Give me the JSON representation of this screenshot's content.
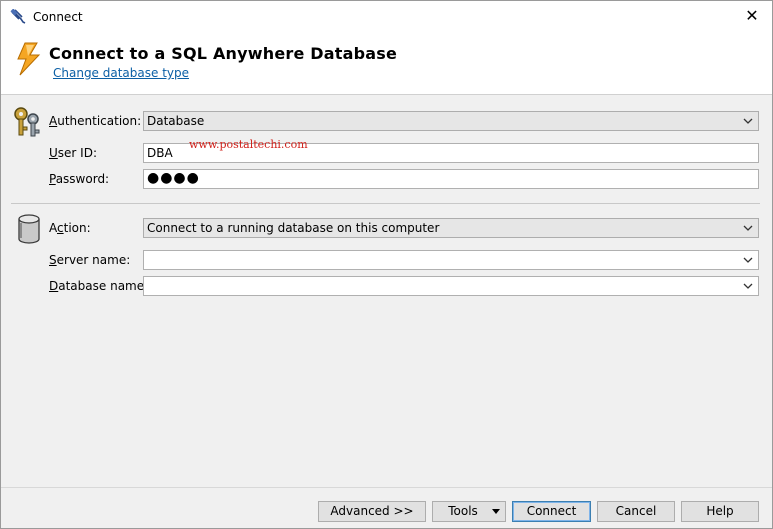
{
  "window": {
    "title": "Connect",
    "close_glyph": "✕"
  },
  "header": {
    "heading": "Connect to a SQL Anywhere Database",
    "change_type_link": "Change database type"
  },
  "auth_section": {
    "authentication_label_prefix": "",
    "authentication_label_mnemonic": "A",
    "authentication_label_rest": "uthentication:",
    "authentication_value": "Database",
    "user_id_label_mnemonic": "U",
    "user_id_label_rest": "ser ID:",
    "user_id_value": "DBA",
    "password_label_mnemonic": "P",
    "password_label_rest": "assword:",
    "password_mask": "●●●●"
  },
  "watermark": "www.postaltechi.com",
  "action_section": {
    "action_label_prefix": "A",
    "action_label_mnemonic": "c",
    "action_label_rest": "tion:",
    "action_value": "Connect to a running database on this computer",
    "server_label_prefix": "",
    "server_label_mnemonic": "S",
    "server_label_rest": "erver name:",
    "server_value": "",
    "database_label_mnemonic": "D",
    "database_label_rest": "atabase name:",
    "database_value": ""
  },
  "buttons": {
    "advanced": "Advanced >>",
    "tools": "Tools",
    "connect": "Connect",
    "cancel": "Cancel",
    "help": "Help"
  },
  "icons": {
    "app": "plug-icon",
    "bolt": "lightning-bolt-icon",
    "keys": "keys-icon",
    "database": "database-cylinder-icon",
    "chevron": "chevron-down-icon"
  },
  "colors": {
    "link": "#0b5fa5",
    "watermark": "#d0201a",
    "bolt": "#f5a623",
    "default_button_border": "#3c7fb1"
  }
}
